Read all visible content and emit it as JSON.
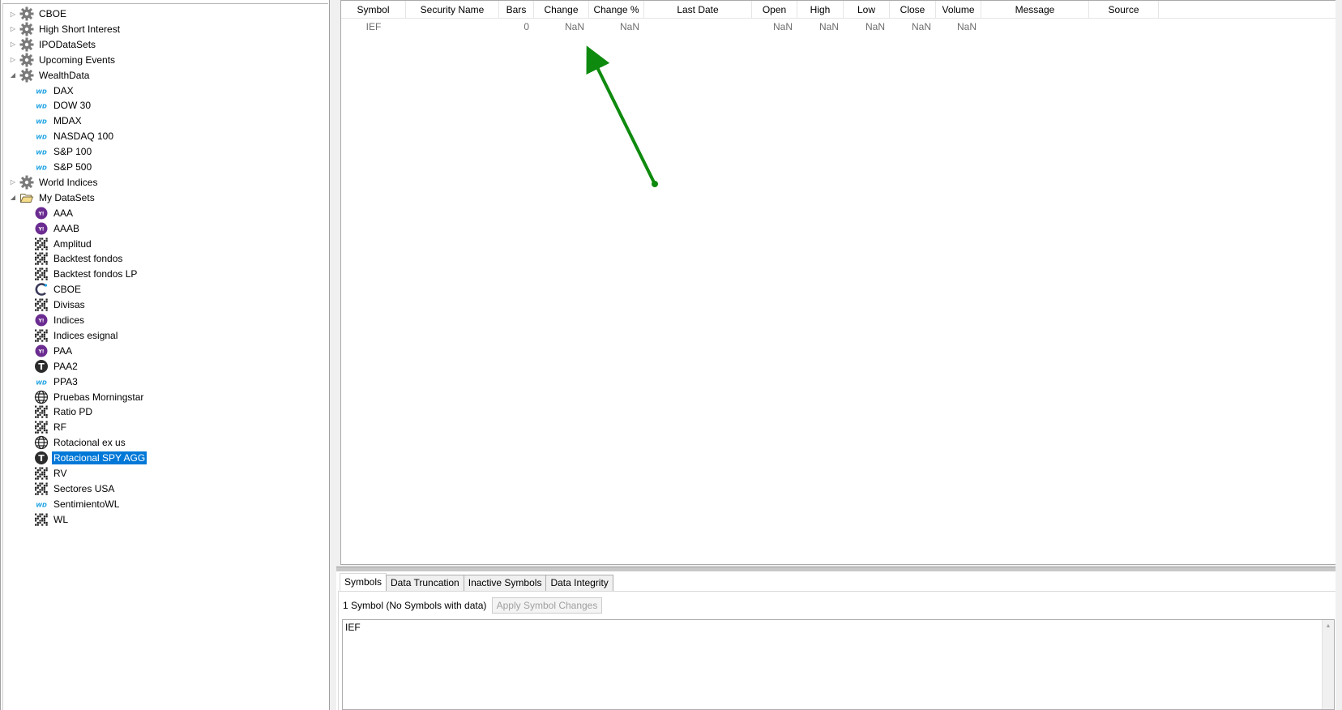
{
  "tree": {
    "items": [
      {
        "label": "CBOE",
        "icon": "gear-icon",
        "level": 0,
        "expander": "collapsed"
      },
      {
        "label": "High Short Interest",
        "icon": "gear-icon",
        "level": 0,
        "expander": "collapsed"
      },
      {
        "label": "IPODataSets",
        "icon": "gear-icon",
        "level": 0,
        "expander": "collapsed"
      },
      {
        "label": "Upcoming Events",
        "icon": "gear-icon",
        "level": 0,
        "expander": "collapsed"
      },
      {
        "label": "WealthData",
        "icon": "gear-icon",
        "level": 0,
        "expander": "expanded"
      },
      {
        "label": "DAX",
        "icon": "wd-icon",
        "level": 1
      },
      {
        "label": "DOW 30",
        "icon": "wd-icon",
        "level": 1
      },
      {
        "label": "MDAX",
        "icon": "wd-icon",
        "level": 1
      },
      {
        "label": "NASDAQ 100",
        "icon": "wd-icon",
        "level": 1
      },
      {
        "label": "S&P 100",
        "icon": "wd-icon",
        "level": 1
      },
      {
        "label": "S&P 500",
        "icon": "wd-icon",
        "level": 1
      },
      {
        "label": "World Indices",
        "icon": "gear-icon",
        "level": 0,
        "expander": "collapsed"
      },
      {
        "label": "My DataSets",
        "icon": "folder-open-icon",
        "level": 0,
        "expander": "expanded"
      },
      {
        "label": "AAA",
        "icon": "yahoo-icon",
        "level": 1
      },
      {
        "label": "AAAB",
        "icon": "yahoo-icon",
        "level": 1
      },
      {
        "label": "Amplitud",
        "icon": "ascii-icon",
        "level": 1
      },
      {
        "label": "Backtest fondos",
        "icon": "ascii-icon",
        "level": 1
      },
      {
        "label": "Backtest fondos LP",
        "icon": "ascii-icon",
        "level": 1
      },
      {
        "label": "CBOE",
        "icon": "cboe-icon",
        "level": 1
      },
      {
        "label": "Divisas",
        "icon": "ascii-icon",
        "level": 1
      },
      {
        "label": "Indices",
        "icon": "yahoo-icon",
        "level": 1
      },
      {
        "label": "Indices esignal",
        "icon": "ascii-icon",
        "level": 1
      },
      {
        "label": "PAA",
        "icon": "yahoo-icon",
        "level": 1
      },
      {
        "label": "PAA2",
        "icon": "tiingo-icon",
        "level": 1
      },
      {
        "label": "PPA3",
        "icon": "wd-icon",
        "level": 1
      },
      {
        "label": "Pruebas Morningstar",
        "icon": "globe-icon",
        "level": 1
      },
      {
        "label": "Ratio PD",
        "icon": "ascii-icon",
        "level": 1
      },
      {
        "label": "RF",
        "icon": "ascii-icon",
        "level": 1
      },
      {
        "label": "Rotacional ex us",
        "icon": "globe-icon",
        "level": 1
      },
      {
        "label": "Rotacional SPY AGG",
        "icon": "tiingo-icon",
        "level": 1,
        "selected": true
      },
      {
        "label": "RV",
        "icon": "ascii-icon",
        "level": 1
      },
      {
        "label": "Sectores USA",
        "icon": "ascii-icon",
        "level": 1
      },
      {
        "label": "SentimientoWL",
        "icon": "wd-icon",
        "level": 1
      },
      {
        "label": "WL",
        "icon": "ascii-icon",
        "level": 1
      }
    ],
    "icon_text": {
      "wd": "WD",
      "yahoo": "Y!",
      "tiingo": "T"
    }
  },
  "grid": {
    "columns": [
      "Symbol",
      "Security Name",
      "Bars",
      "Change",
      "Change %",
      "Last Date",
      "Open",
      "High",
      "Low",
      "Close",
      "Volume",
      "Message",
      "Source"
    ],
    "rows": [
      {
        "symbol": "IEF",
        "security_name": "",
        "bars": "0",
        "change": "NaN",
        "change_pct": "NaN",
        "last_date": "",
        "open": "NaN",
        "high": "NaN",
        "low": "NaN",
        "close": "NaN",
        "volume": "NaN",
        "message": "",
        "source": ""
      }
    ],
    "annotation_color": "#0e8a0e"
  },
  "bottom": {
    "tabs": [
      "Symbols",
      "Data Truncation",
      "Inactive Symbols",
      "Data Integrity"
    ],
    "active_tab": "Symbols",
    "status": "1 Symbol (No Symbols with data)",
    "apply_button": "Apply Symbol Changes",
    "symbols_text": "IEF"
  },
  "colors": {
    "selection": "#0078d7",
    "gear": "#7a7a7a",
    "wd": "#1ba1e2",
    "yahoo": "#6b2c91",
    "tiingo": "#2b2b2b"
  }
}
